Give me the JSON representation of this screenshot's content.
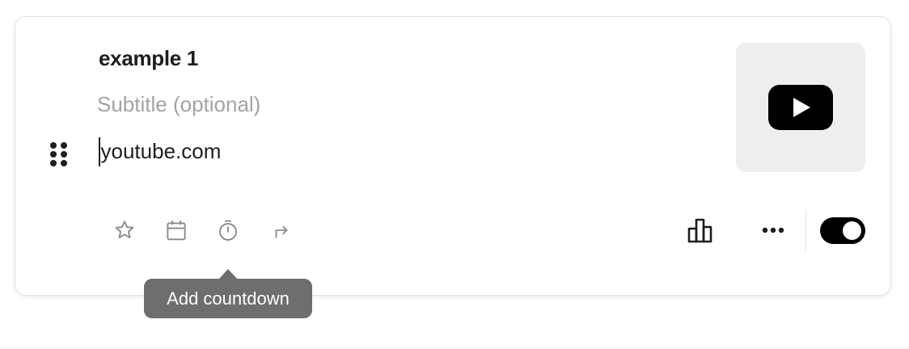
{
  "link": {
    "title": "example 1",
    "subtitle_placeholder": "Subtitle (optional)",
    "url": "youtube.com",
    "thumbnail_icon": "youtube-icon",
    "enabled": true
  },
  "toolbar": {
    "left_icons": [
      "star-icon",
      "calendar-icon",
      "timer-icon",
      "redirect-arrow-icon"
    ],
    "right_icons": [
      "analytics-icon",
      "more-icon"
    ]
  },
  "tooltip": {
    "text": "Add countdown"
  },
  "colors": {
    "text": "#1e1e1e",
    "placeholder": "#a3a3a3",
    "icon_muted": "#8a8a8a",
    "tooltip_bg": "#6e6e6e",
    "thumbnail_bg": "#eeeeee",
    "toggle_on": "#000000"
  }
}
